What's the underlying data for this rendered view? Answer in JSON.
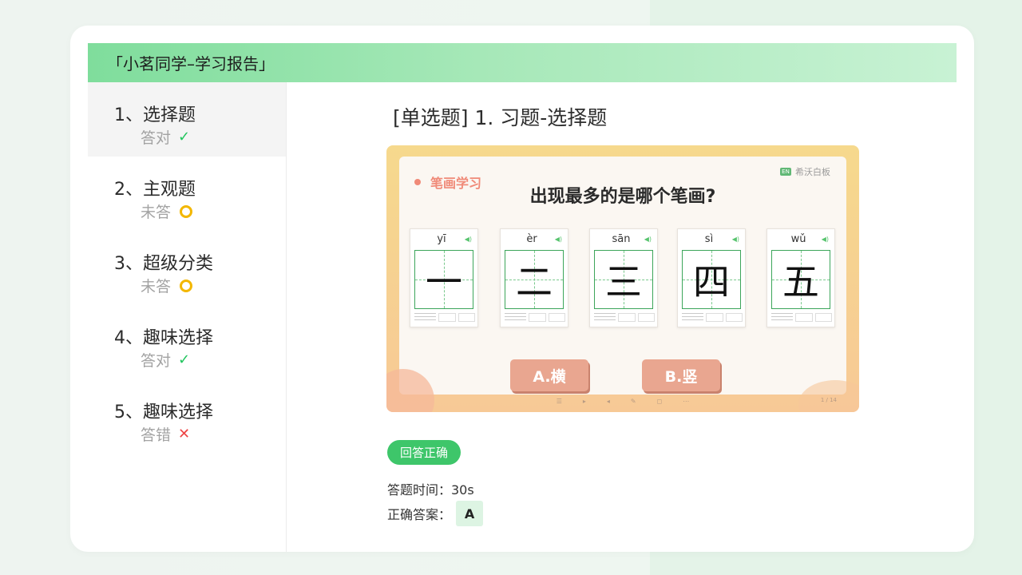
{
  "header": {
    "title": "「小茗同学–学习报告」"
  },
  "sidebar": {
    "items": [
      {
        "title": "1、选择题",
        "status": "答对",
        "icon": "check-icon",
        "active": true
      },
      {
        "title": "2、主观题",
        "status": "未答",
        "icon": "circle-icon",
        "active": false
      },
      {
        "title": "3、超级分类",
        "status": "未答",
        "icon": "circle-icon",
        "active": false
      },
      {
        "title": "4、趣味选择",
        "status": "答对",
        "icon": "check-icon",
        "active": false
      },
      {
        "title": "5、趣味选择",
        "status": "答错",
        "icon": "cross-icon",
        "active": false
      }
    ]
  },
  "main": {
    "title": "[单选题] 1. 习题-选择题",
    "slide": {
      "tag": "笔画学习",
      "brand": "希沃白板",
      "question": "出现最多的是哪个笔画?",
      "cards": [
        {
          "pinyin": "yī",
          "char": "一"
        },
        {
          "pinyin": "èr",
          "char": "二"
        },
        {
          "pinyin": "sān",
          "char": "三"
        },
        {
          "pinyin": "sì",
          "char": "四"
        },
        {
          "pinyin": "wǔ",
          "char": "五"
        }
      ],
      "options": [
        "A.横",
        "B.竖"
      ],
      "page_indicator": "1 / 14"
    },
    "result_badge": "回答正确",
    "time_label": "答题时间：30s",
    "answer_label": "正确答案：",
    "answer_value": "A"
  },
  "colors": {
    "accent_green": "#3ec66a",
    "header_gradient_start": "#7fdd9c",
    "check": "#22c55e",
    "pending_ring": "#f3b700",
    "wrong": "#ee4444",
    "option_button": "#e9a690"
  }
}
